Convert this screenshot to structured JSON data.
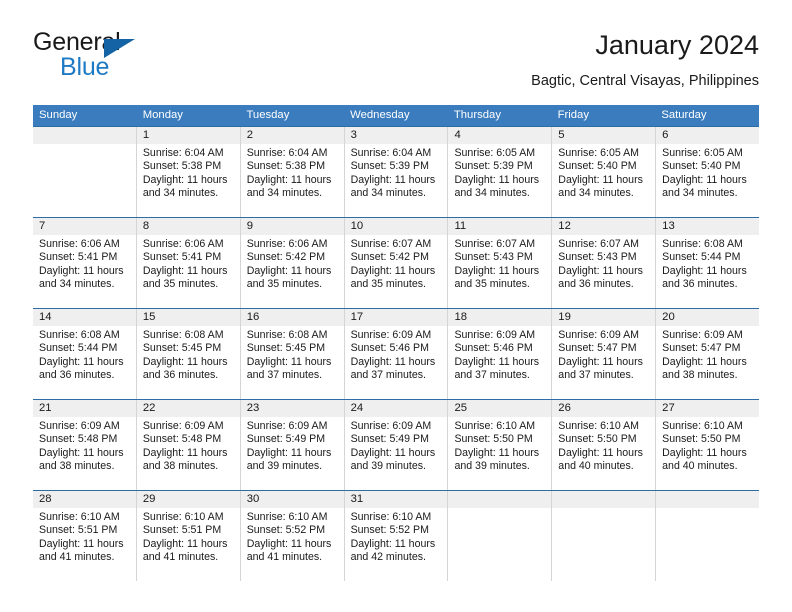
{
  "brand": {
    "line1": "General",
    "line2": "Blue",
    "triangle_color": "#1464a5",
    "blue_color": "#1f7ac4"
  },
  "header": {
    "title": "January 2024",
    "subtitle": "Bagtic, Central Visayas, Philippines"
  },
  "theme": {
    "header_bar": "#3a7cbe",
    "week_rule": "#2e6da4",
    "daynum_band": "#efefef",
    "cell_border": "#d5d5d5",
    "text": "#1a1a1a"
  },
  "weekdays": [
    "Sunday",
    "Monday",
    "Tuesday",
    "Wednesday",
    "Thursday",
    "Friday",
    "Saturday"
  ],
  "weeks": [
    {
      "days": [
        {
          "num": "",
          "sunrise": "",
          "sunset": "",
          "daylight1": "",
          "daylight2": "",
          "empty": true
        },
        {
          "num": "1",
          "sunrise": "Sunrise: 6:04 AM",
          "sunset": "Sunset: 5:38 PM",
          "daylight1": "Daylight: 11 hours",
          "daylight2": "and 34 minutes.",
          "empty": false
        },
        {
          "num": "2",
          "sunrise": "Sunrise: 6:04 AM",
          "sunset": "Sunset: 5:38 PM",
          "daylight1": "Daylight: 11 hours",
          "daylight2": "and 34 minutes.",
          "empty": false
        },
        {
          "num": "3",
          "sunrise": "Sunrise: 6:04 AM",
          "sunset": "Sunset: 5:39 PM",
          "daylight1": "Daylight: 11 hours",
          "daylight2": "and 34 minutes.",
          "empty": false
        },
        {
          "num": "4",
          "sunrise": "Sunrise: 6:05 AM",
          "sunset": "Sunset: 5:39 PM",
          "daylight1": "Daylight: 11 hours",
          "daylight2": "and 34 minutes.",
          "empty": false
        },
        {
          "num": "5",
          "sunrise": "Sunrise: 6:05 AM",
          "sunset": "Sunset: 5:40 PM",
          "daylight1": "Daylight: 11 hours",
          "daylight2": "and 34 minutes.",
          "empty": false
        },
        {
          "num": "6",
          "sunrise": "Sunrise: 6:05 AM",
          "sunset": "Sunset: 5:40 PM",
          "daylight1": "Daylight: 11 hours",
          "daylight2": "and 34 minutes.",
          "empty": false
        }
      ]
    },
    {
      "days": [
        {
          "num": "7",
          "sunrise": "Sunrise: 6:06 AM",
          "sunset": "Sunset: 5:41 PM",
          "daylight1": "Daylight: 11 hours",
          "daylight2": "and 34 minutes.",
          "empty": false
        },
        {
          "num": "8",
          "sunrise": "Sunrise: 6:06 AM",
          "sunset": "Sunset: 5:41 PM",
          "daylight1": "Daylight: 11 hours",
          "daylight2": "and 35 minutes.",
          "empty": false
        },
        {
          "num": "9",
          "sunrise": "Sunrise: 6:06 AM",
          "sunset": "Sunset: 5:42 PM",
          "daylight1": "Daylight: 11 hours",
          "daylight2": "and 35 minutes.",
          "empty": false
        },
        {
          "num": "10",
          "sunrise": "Sunrise: 6:07 AM",
          "sunset": "Sunset: 5:42 PM",
          "daylight1": "Daylight: 11 hours",
          "daylight2": "and 35 minutes.",
          "empty": false
        },
        {
          "num": "11",
          "sunrise": "Sunrise: 6:07 AM",
          "sunset": "Sunset: 5:43 PM",
          "daylight1": "Daylight: 11 hours",
          "daylight2": "and 35 minutes.",
          "empty": false
        },
        {
          "num": "12",
          "sunrise": "Sunrise: 6:07 AM",
          "sunset": "Sunset: 5:43 PM",
          "daylight1": "Daylight: 11 hours",
          "daylight2": "and 36 minutes.",
          "empty": false
        },
        {
          "num": "13",
          "sunrise": "Sunrise: 6:08 AM",
          "sunset": "Sunset: 5:44 PM",
          "daylight1": "Daylight: 11 hours",
          "daylight2": "and 36 minutes.",
          "empty": false
        }
      ]
    },
    {
      "days": [
        {
          "num": "14",
          "sunrise": "Sunrise: 6:08 AM",
          "sunset": "Sunset: 5:44 PM",
          "daylight1": "Daylight: 11 hours",
          "daylight2": "and 36 minutes.",
          "empty": false
        },
        {
          "num": "15",
          "sunrise": "Sunrise: 6:08 AM",
          "sunset": "Sunset: 5:45 PM",
          "daylight1": "Daylight: 11 hours",
          "daylight2": "and 36 minutes.",
          "empty": false
        },
        {
          "num": "16",
          "sunrise": "Sunrise: 6:08 AM",
          "sunset": "Sunset: 5:45 PM",
          "daylight1": "Daylight: 11 hours",
          "daylight2": "and 37 minutes.",
          "empty": false
        },
        {
          "num": "17",
          "sunrise": "Sunrise: 6:09 AM",
          "sunset": "Sunset: 5:46 PM",
          "daylight1": "Daylight: 11 hours",
          "daylight2": "and 37 minutes.",
          "empty": false
        },
        {
          "num": "18",
          "sunrise": "Sunrise: 6:09 AM",
          "sunset": "Sunset: 5:46 PM",
          "daylight1": "Daylight: 11 hours",
          "daylight2": "and 37 minutes.",
          "empty": false
        },
        {
          "num": "19",
          "sunrise": "Sunrise: 6:09 AM",
          "sunset": "Sunset: 5:47 PM",
          "daylight1": "Daylight: 11 hours",
          "daylight2": "and 37 minutes.",
          "empty": false
        },
        {
          "num": "20",
          "sunrise": "Sunrise: 6:09 AM",
          "sunset": "Sunset: 5:47 PM",
          "daylight1": "Daylight: 11 hours",
          "daylight2": "and 38 minutes.",
          "empty": false
        }
      ]
    },
    {
      "days": [
        {
          "num": "21",
          "sunrise": "Sunrise: 6:09 AM",
          "sunset": "Sunset: 5:48 PM",
          "daylight1": "Daylight: 11 hours",
          "daylight2": "and 38 minutes.",
          "empty": false
        },
        {
          "num": "22",
          "sunrise": "Sunrise: 6:09 AM",
          "sunset": "Sunset: 5:48 PM",
          "daylight1": "Daylight: 11 hours",
          "daylight2": "and 38 minutes.",
          "empty": false
        },
        {
          "num": "23",
          "sunrise": "Sunrise: 6:09 AM",
          "sunset": "Sunset: 5:49 PM",
          "daylight1": "Daylight: 11 hours",
          "daylight2": "and 39 minutes.",
          "empty": false
        },
        {
          "num": "24",
          "sunrise": "Sunrise: 6:09 AM",
          "sunset": "Sunset: 5:49 PM",
          "daylight1": "Daylight: 11 hours",
          "daylight2": "and 39 minutes.",
          "empty": false
        },
        {
          "num": "25",
          "sunrise": "Sunrise: 6:10 AM",
          "sunset": "Sunset: 5:50 PM",
          "daylight1": "Daylight: 11 hours",
          "daylight2": "and 39 minutes.",
          "empty": false
        },
        {
          "num": "26",
          "sunrise": "Sunrise: 6:10 AM",
          "sunset": "Sunset: 5:50 PM",
          "daylight1": "Daylight: 11 hours",
          "daylight2": "and 40 minutes.",
          "empty": false
        },
        {
          "num": "27",
          "sunrise": "Sunrise: 6:10 AM",
          "sunset": "Sunset: 5:50 PM",
          "daylight1": "Daylight: 11 hours",
          "daylight2": "and 40 minutes.",
          "empty": false
        }
      ]
    },
    {
      "days": [
        {
          "num": "28",
          "sunrise": "Sunrise: 6:10 AM",
          "sunset": "Sunset: 5:51 PM",
          "daylight1": "Daylight: 11 hours",
          "daylight2": "and 41 minutes.",
          "empty": false
        },
        {
          "num": "29",
          "sunrise": "Sunrise: 6:10 AM",
          "sunset": "Sunset: 5:51 PM",
          "daylight1": "Daylight: 11 hours",
          "daylight2": "and 41 minutes.",
          "empty": false
        },
        {
          "num": "30",
          "sunrise": "Sunrise: 6:10 AM",
          "sunset": "Sunset: 5:52 PM",
          "daylight1": "Daylight: 11 hours",
          "daylight2": "and 41 minutes.",
          "empty": false
        },
        {
          "num": "31",
          "sunrise": "Sunrise: 6:10 AM",
          "sunset": "Sunset: 5:52 PM",
          "daylight1": "Daylight: 11 hours",
          "daylight2": "and 42 minutes.",
          "empty": false
        },
        {
          "num": "",
          "sunrise": "",
          "sunset": "",
          "daylight1": "",
          "daylight2": "",
          "empty": true
        },
        {
          "num": "",
          "sunrise": "",
          "sunset": "",
          "daylight1": "",
          "daylight2": "",
          "empty": true
        },
        {
          "num": "",
          "sunrise": "",
          "sunset": "",
          "daylight1": "",
          "daylight2": "",
          "empty": true
        }
      ]
    }
  ]
}
